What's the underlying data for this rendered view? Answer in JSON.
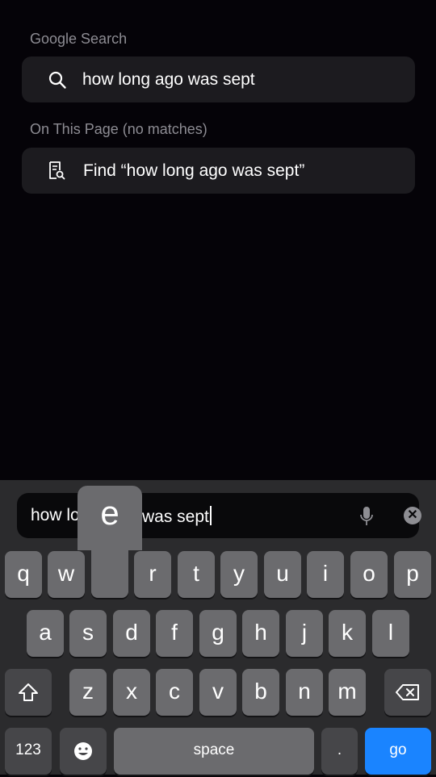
{
  "suggestions": {
    "google_label": "Google Search",
    "google_query": "how long ago was sept",
    "page_label": "On This Page (no matches)",
    "find_text": "Find “how long ago was sept”"
  },
  "address_bar": {
    "before_popup": "how lo",
    "after_popup": "was sept"
  },
  "key_popup": "e",
  "keyboard": {
    "row1": [
      "q",
      "w",
      "e",
      "r",
      "t",
      "y",
      "u",
      "i",
      "o",
      "p"
    ],
    "row2": [
      "a",
      "s",
      "d",
      "f",
      "g",
      "h",
      "j",
      "k",
      "l"
    ],
    "row3": [
      "z",
      "x",
      "c",
      "v",
      "b",
      "n",
      "m"
    ],
    "numbers_label": "123",
    "space_label": "space",
    "period_label": ".",
    "go_label": "go"
  },
  "colors": {
    "accent": "#1a84ff",
    "background": "#050308"
  }
}
